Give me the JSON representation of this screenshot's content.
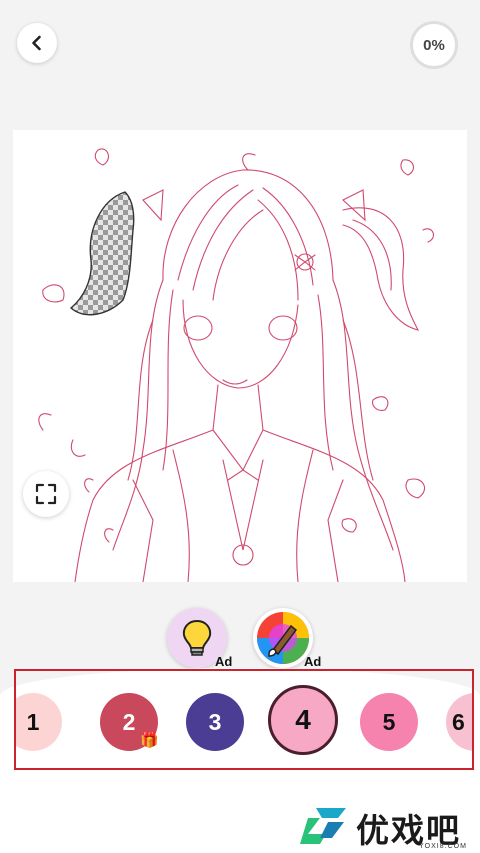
{
  "header": {
    "back_icon": "chevron-left-icon",
    "progress": "0%"
  },
  "canvas": {
    "artwork": "anime girl line art",
    "line_color": "#d04a6e"
  },
  "tools": {
    "hint": {
      "icon": "lightbulb-icon",
      "ad_label": "Ad"
    },
    "rainbow_brush": {
      "icon": "rainbow-brush-icon",
      "ad_label": "Ad"
    }
  },
  "palette": {
    "selected": "4",
    "swatches": [
      {
        "number": "1",
        "color": "#fdd4d4"
      },
      {
        "number": "2",
        "color": "#c9485b",
        "has_gift": true
      },
      {
        "number": "3",
        "color": "#4b3d93"
      },
      {
        "number": "4",
        "color": "#f7a8c4"
      },
      {
        "number": "5",
        "color": "#f683ad"
      },
      {
        "number": "6",
        "color": "#f7c1d2"
      }
    ]
  },
  "watermark": {
    "cn": "优戏吧",
    "en": "YOXI8.COM"
  }
}
